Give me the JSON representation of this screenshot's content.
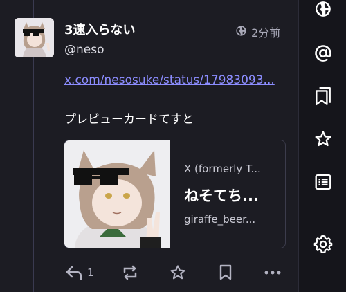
{
  "post": {
    "display_name": "3速入らない",
    "handle": "@neso",
    "visibility_icon": "globe-icon",
    "time": "2分前",
    "link_text": "x.com/nesosuke/status/17983093...",
    "text": "プレビューカードてすと",
    "card": {
      "provider": "X (formerly T...",
      "title": "ねそてち...",
      "description": "giraffe_beer..."
    },
    "actions": {
      "reply_count": "1",
      "icons": [
        "reply-icon",
        "boost-icon",
        "favourite-icon",
        "bookmark-icon",
        "more-icon"
      ]
    }
  },
  "sidebar": {
    "icons": [
      "globe-icon",
      "at-icon",
      "bookmarks-icon",
      "star-icon",
      "list-icon",
      "settings-icon"
    ]
  },
  "colors": {
    "background": "#1c1c23",
    "link": "#8c8dff",
    "muted": "#a9a9b8",
    "icon": "#b3b3c2"
  }
}
